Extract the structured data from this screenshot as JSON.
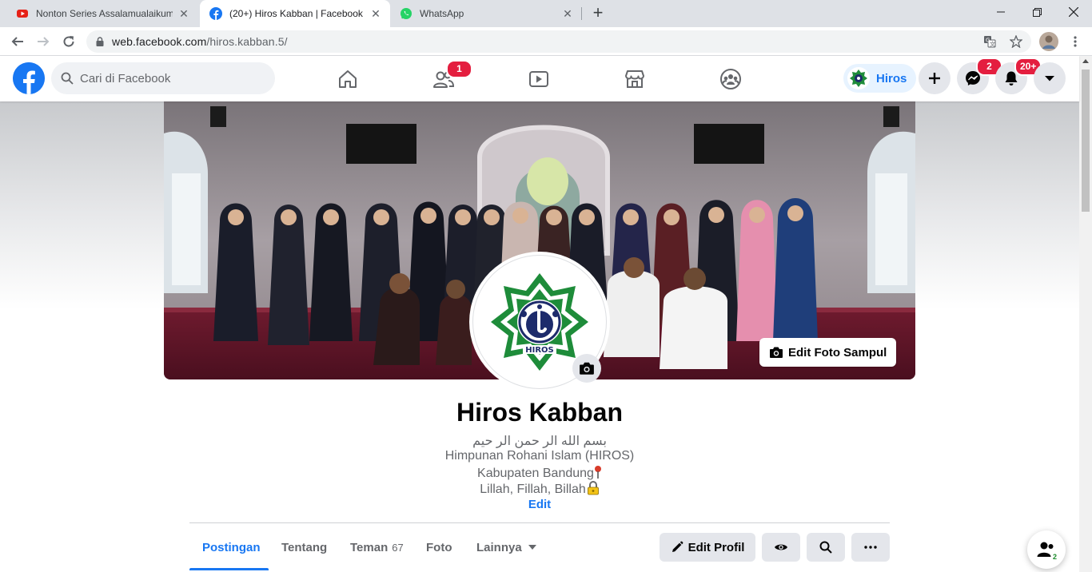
{
  "browser": {
    "tabs": [
      {
        "title": "Nonton Series Assalamualaikum",
        "icon": "youtube-icon",
        "active": false
      },
      {
        "title": "(20+) Hiros Kabban | Facebook",
        "icon": "facebook-icon",
        "active": true
      },
      {
        "title": "WhatsApp",
        "icon": "whatsapp-icon",
        "active": false
      }
    ],
    "url_host": "web.facebook.com",
    "url_path": "/hiros.kabban.5/"
  },
  "fb_header": {
    "search_placeholder": "Cari di Facebook",
    "friends_badge": "1",
    "profile_chip_name": "Hiros",
    "messenger_badge": "2",
    "notifications_badge": "20+"
  },
  "profile": {
    "name": "Hiros Kabban",
    "bio_lines": [
      "بسم الله الر حمن الر حيم",
      "Himpunan Rohani Islam (HIROS)",
      "Kabupaten Bandung",
      "Lillah, Fillah, Billah"
    ],
    "bio_edit": "Edit",
    "edit_cover_label": "Edit Foto Sampul",
    "logo_text": "HIROS"
  },
  "profile_tabs": {
    "posts": "Postingan",
    "about": "Tentang",
    "friends": "Teman",
    "friends_count": "67",
    "photos": "Foto",
    "more": "Lainnya"
  },
  "actions": {
    "edit_profile": "Edit Profil"
  },
  "friends_fab_count": "2",
  "colors": {
    "fb_blue": "#1877f2",
    "badge_red": "#e41e3f",
    "logo_green": "#1e8c3a",
    "logo_navy": "#1d2b6b"
  }
}
